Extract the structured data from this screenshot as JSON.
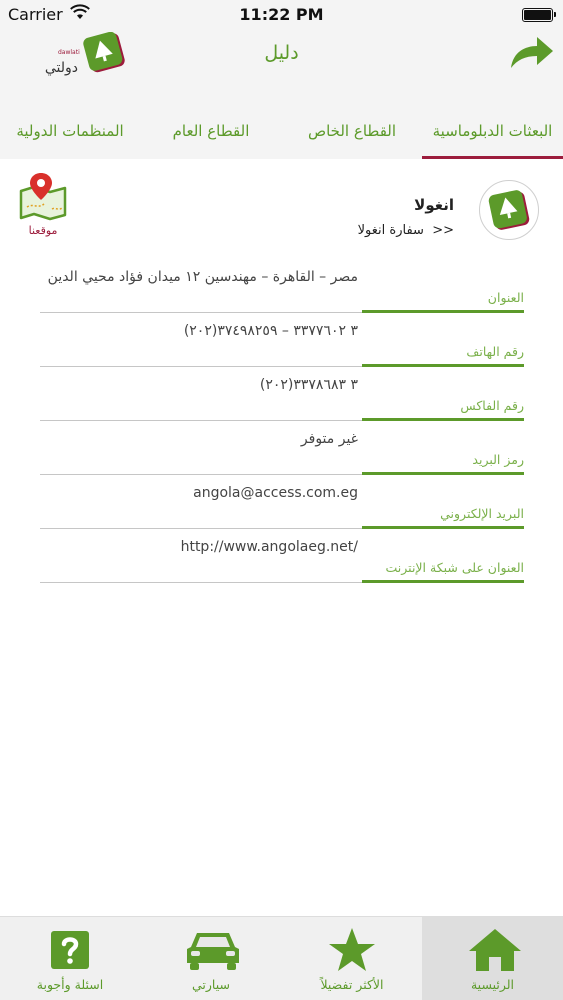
{
  "status_bar": {
    "carrier": "Carrier",
    "time": "11:22 PM"
  },
  "header": {
    "title": "دليل",
    "logo_text": "دولتي",
    "logo_small": "dawlati"
  },
  "tabs": [
    {
      "label": "البعثات الدبلوماسية",
      "active": true
    },
    {
      "label": "القطاع الخاص",
      "active": false
    },
    {
      "label": "القطاع العام",
      "active": false
    },
    {
      "label": "المنظمات الدولية",
      "active": false
    }
  ],
  "entry": {
    "country": "انغولا",
    "embassy": "سفارة انغولا",
    "breadcrumb_marker": ">>",
    "map_label": "موقعنا"
  },
  "fields": [
    {
      "label": "العنوان",
      "value": "مصر – القاهرة – مهندسين ١٢ ميدان فؤاد محيي الدين"
    },
    {
      "label": "رقم الهاتف",
      "value": "(٢٠٢)٣ ٣٣٧٧٦٠٢ – ٣٧٤٩٨٢٥٩"
    },
    {
      "label": "رقم الفاكس",
      "value": "(٢٠٢)٣ ٣٣٧٨٦٨٣"
    },
    {
      "label": "رمز البريد",
      "value": "غير متوفر"
    },
    {
      "label": "البريد الإلكتروني",
      "value": "angola@access.com.eg"
    },
    {
      "label": "العنوان على شبكة الإنترنت",
      "value": "http://www.angolaeg.net/"
    }
  ],
  "tabbar": [
    {
      "label": "الرئيسية",
      "icon": "home-icon",
      "active": true
    },
    {
      "label": "الأكثر تفضيلاً",
      "icon": "star-icon",
      "active": false
    },
    {
      "label": "سيارتي",
      "icon": "car-icon",
      "active": false
    },
    {
      "label": "اسئلة وأجوبة",
      "icon": "question-icon",
      "active": false
    }
  ],
  "colors": {
    "accent": "#5c9a2a",
    "brand": "#9c1c3c"
  }
}
